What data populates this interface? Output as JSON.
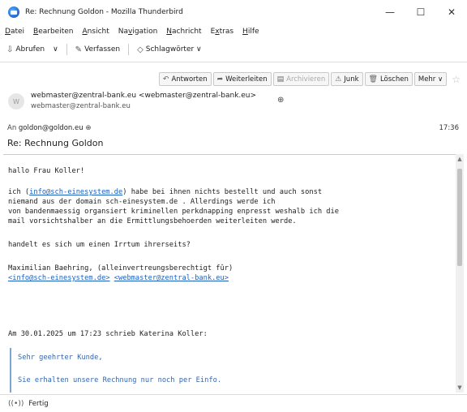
{
  "window": {
    "title": "Re: Rechnung Goldon - Mozilla Thunderbird",
    "minimize": "—",
    "maximize": "☐",
    "close": "✕"
  },
  "menu": [
    {
      "pre": "",
      "acc": "D",
      "post": "atei"
    },
    {
      "pre": "",
      "acc": "B",
      "post": "earbeiten"
    },
    {
      "pre": "",
      "acc": "A",
      "post": "nsicht"
    },
    {
      "pre": "Na",
      "acc": "v",
      "post": "igation"
    },
    {
      "pre": "",
      "acc": "N",
      "post": "achricht"
    },
    {
      "pre": "E",
      "acc": "x",
      "post": "tras"
    },
    {
      "pre": "",
      "acc": "H",
      "post": "ilfe"
    }
  ],
  "toolbar": {
    "get_mail": "Abrufen",
    "get_mail_dropdown": "∨",
    "write": "Verfassen",
    "tags": "Schlagwörter ∨"
  },
  "message_toolbar": {
    "reply": "Antworten",
    "forward": "Weiterleiten",
    "archive": "Archivieren",
    "junk": "Junk",
    "delete": "Löschen",
    "more": "Mehr ∨"
  },
  "header": {
    "avatar_letter": "W",
    "from": "webmaster@zentral-bank.eu <webmaster@zentral-bank.eu>",
    "from_sub": "webmaster@zentral-bank.eu",
    "to_label": "An",
    "to": "goldon@goldon.eu",
    "time": "17:36",
    "subject": "Re: Rechnung Goldon"
  },
  "body": {
    "greeting": "hallo Frau Koller!",
    "p1_pre": "ich (",
    "p1_link": "info@sch-einesystem.de",
    "p1_post": ") habe bei ihnen nichts bestellt und auch sonst",
    "p1_line2": "niemand aus der domain sch-einesystem.de . Allerdings werde ich",
    "p1_line3": "von bandenmaessig organsiert kriminellen perkdnapping enpresst weshalb ich die",
    "p1_line4": "mail vorsichtshalber an die Ermittlungsbehoerden weiterleiten werde.",
    "question": "handelt es sich um einen Irrtum ihrerseits?",
    "sig_line1": "Maximilian Baehring, (alleinvertreungsberechtigt fûr)",
    "sig_link1": "<info@sch-einesystem.de>",
    "sig_link2": "<webmaster@zentral-bank.eu>",
    "quote_header": "Am 30.01.2025 um 17:23 schrieb Katerina Koller:",
    "quote_line1": "Sehr geehrter Kunde,",
    "quote_line2": "Sie erhalten unsere Rechnung nur noch per Einfo."
  },
  "status": {
    "text": "Fertig"
  },
  "colors": {
    "link": "#1a5fbf",
    "quote": "#3566b0"
  }
}
